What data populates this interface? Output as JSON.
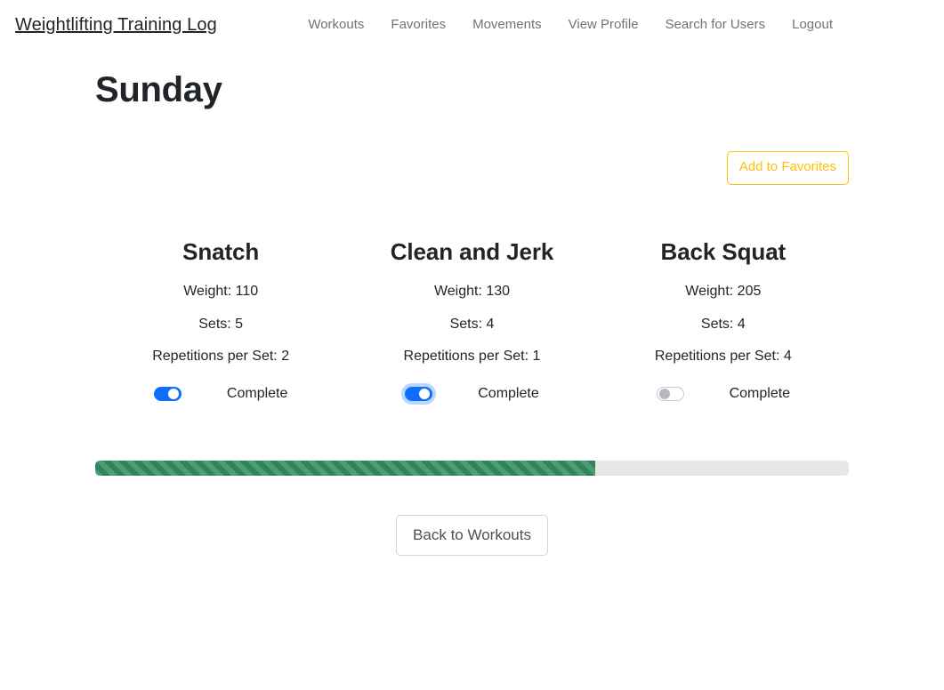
{
  "navbar": {
    "brand": "Weightlifting Training Log",
    "links": [
      {
        "label": "Workouts",
        "name": "nav-link-workouts"
      },
      {
        "label": "Favorites",
        "name": "nav-link-favorites"
      },
      {
        "label": "Movements",
        "name": "nav-link-movements"
      },
      {
        "label": "View Profile",
        "name": "nav-link-view-profile"
      },
      {
        "label": "Search for Users",
        "name": "nav-link-search-for-users"
      },
      {
        "label": "Logout",
        "name": "nav-link-logout"
      }
    ]
  },
  "page": {
    "title": "Sunday"
  },
  "actions": {
    "add_to_favorites": "Add to Favorites",
    "back_to_workouts": "Back to Workouts"
  },
  "exercises": [
    {
      "name": "Snatch",
      "weight": "Weight: 110",
      "sets": "Sets: 5",
      "reps": "Repetitions per Set: 2",
      "complete_label": "Complete",
      "complete": true,
      "focused": false
    },
    {
      "name": "Clean and Jerk",
      "weight": "Weight: 130",
      "sets": "Sets: 4",
      "reps": "Repetitions per Set: 1",
      "complete_label": "Complete",
      "complete": true,
      "focused": true
    },
    {
      "name": "Back Squat",
      "weight": "Weight: 205",
      "sets": "Sets: 4",
      "reps": "Repetitions per Set: 4",
      "complete_label": "Complete",
      "complete": false,
      "focused": false
    }
  ],
  "progress": {
    "percent": 66.3,
    "completed_count": 2,
    "total_count": 3
  },
  "colors": {
    "accent_warning": "#ffc107",
    "toggle_on": "#0d6efd",
    "progress_fill": "#2d8659",
    "progress_track": "#e5e8ea",
    "text_muted": "#6c757d",
    "text_body": "#212529"
  }
}
